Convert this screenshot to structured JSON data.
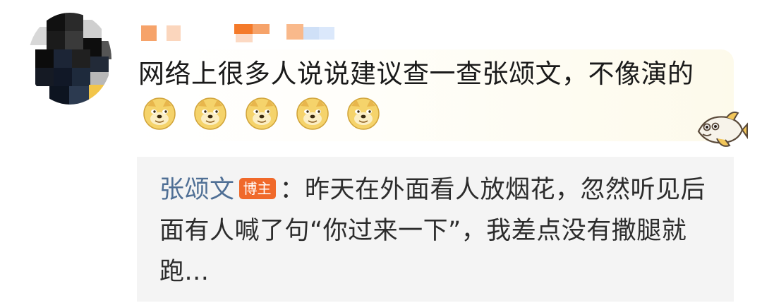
{
  "comment": {
    "text": "网络上很多人说说建议查一查张颂文，不像演的",
    "emoji_icons": [
      "doge-emoji-icon",
      "doge-emoji-icon",
      "doge-emoji-icon",
      "doge-emoji-icon",
      "doge-emoji-icon"
    ],
    "decor_icon": "fish-icon"
  },
  "quote": {
    "author": "张颂文",
    "badge": "博主",
    "separator": "：",
    "text": "昨天在外面看人放烟花，忽然听见后面有人喊了句“你过来一下”，我差点没有撒腿就跑..."
  },
  "colors": {
    "author_link": "#4f6f95",
    "badge_bg": "#f0692a",
    "quote_bg": "#f4f4f4"
  }
}
